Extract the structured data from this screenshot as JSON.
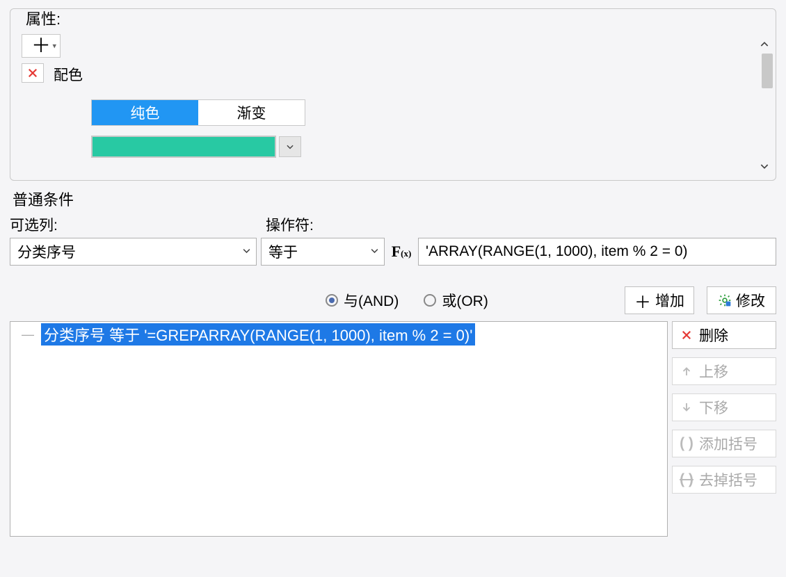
{
  "properties": {
    "title": "属性:",
    "config_label": "配色",
    "tabs": {
      "solid": "纯色",
      "gradient": "渐变"
    },
    "swatch_color": "#28c9a3"
  },
  "conditions": {
    "title": "普通条件",
    "labels": {
      "columns": "可选列:",
      "operator": "操作符:"
    },
    "column_value": "分类序号",
    "operator_value": "等于",
    "formula_value": "'ARRAY(RANGE(1, 1000), item % 2 = 0)",
    "logic": {
      "and": "与(AND)",
      "or": "或(OR)"
    },
    "buttons": {
      "add": "增加",
      "modify": "修改",
      "delete": "删除",
      "move_up": "上移",
      "move_down": "下移",
      "add_bracket": "添加括号",
      "remove_bracket": "去掉括号"
    },
    "tree_item": "分类序号 等于 '=GREPARRAY(RANGE(1, 1000), item % 2 = 0)'"
  }
}
